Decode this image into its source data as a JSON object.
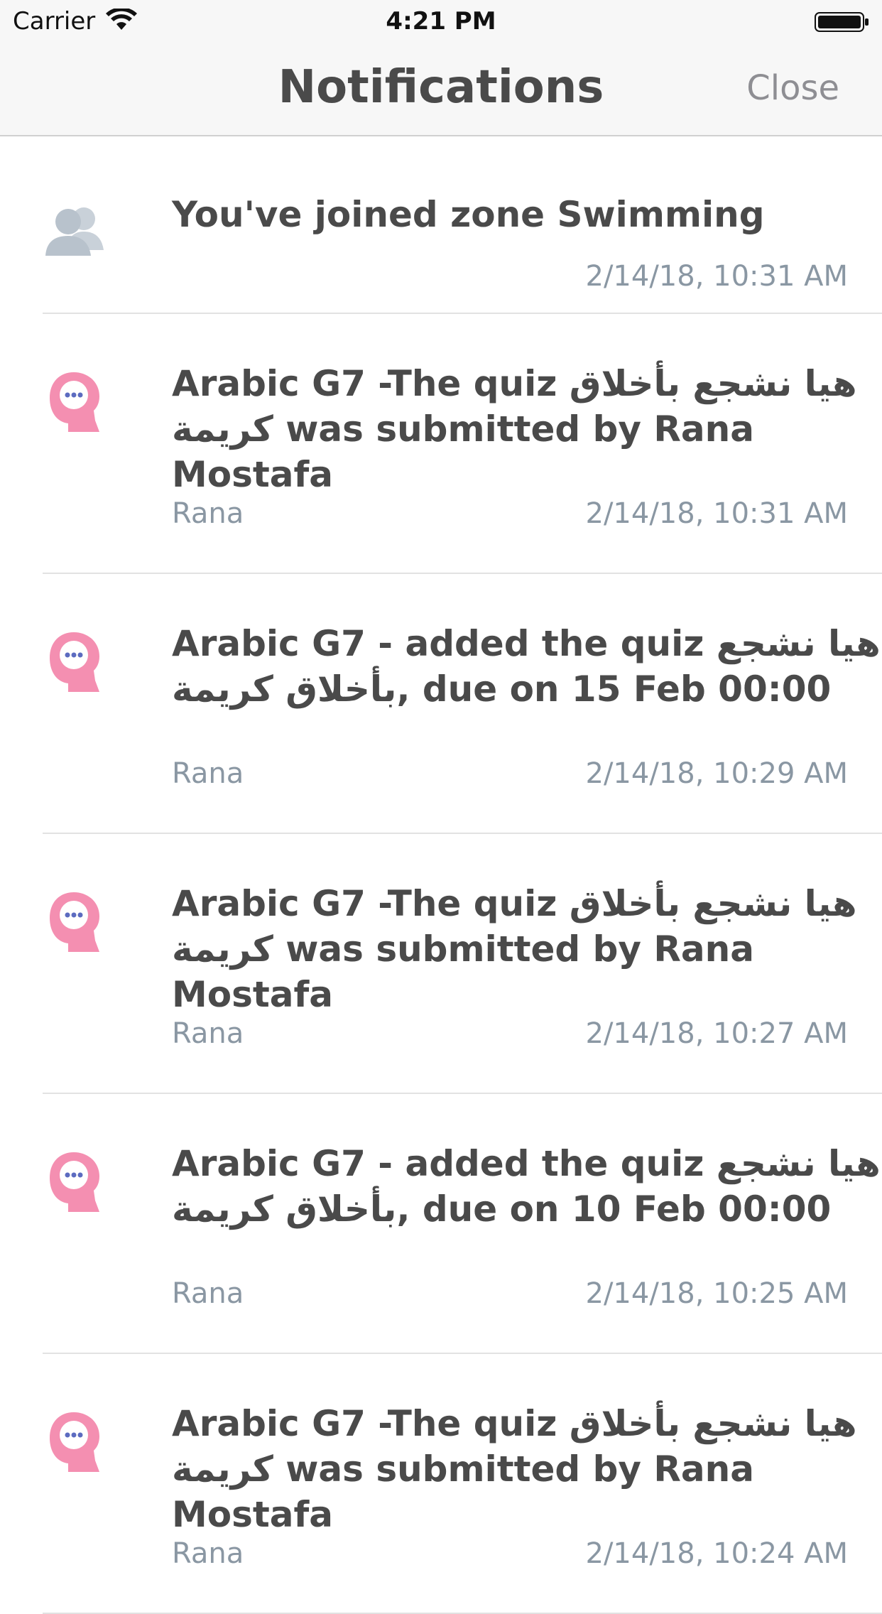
{
  "status_bar": {
    "carrier": "Carrier",
    "time": "4:21 PM"
  },
  "nav": {
    "title": "Notifications",
    "close_label": "Close"
  },
  "notifications": [
    {
      "icon": "group-icon",
      "title": "You've joined zone Swimming",
      "sender": "",
      "time": "2/14/18, 10:31 AM"
    },
    {
      "icon": "chat-head-icon",
      "title": "Arabic G7 -The quiz  هيا نشجع بأخلاق كريمة was submitted by Rana Mostafa",
      "sender": "Rana",
      "time": "2/14/18, 10:31 AM"
    },
    {
      "icon": "chat-head-icon",
      "title": "Arabic G7 -  added the quiz  هيا نشجع بأخلاق كريمة, due on 15 Feb 00:00",
      "sender": "Rana",
      "time": "2/14/18, 10:29 AM"
    },
    {
      "icon": "chat-head-icon",
      "title": "Arabic G7 -The quiz  هيا نشجع بأخلاق كريمة was submitted by Rana Mostafa",
      "sender": "Rana",
      "time": "2/14/18, 10:27 AM"
    },
    {
      "icon": "chat-head-icon",
      "title": "Arabic G7 -  added the quiz  هيا نشجع بأخلاق كريمة, due on 10 Feb 00:00",
      "sender": "Rana",
      "time": "2/14/18, 10:25 AM"
    },
    {
      "icon": "chat-head-icon",
      "title": "Arabic G7 -The quiz  هيا نشجع بأخلاق كريمة was submitted by Rana Mostafa",
      "sender": "Rana",
      "time": "2/14/18, 10:24 AM"
    }
  ],
  "colors": {
    "chat_icon_pink": "#f48fb1",
    "chat_icon_dots": "#5c6bc0",
    "group_icon_gray": "#b8c2cc",
    "secondary_text": "#8a97a3"
  }
}
